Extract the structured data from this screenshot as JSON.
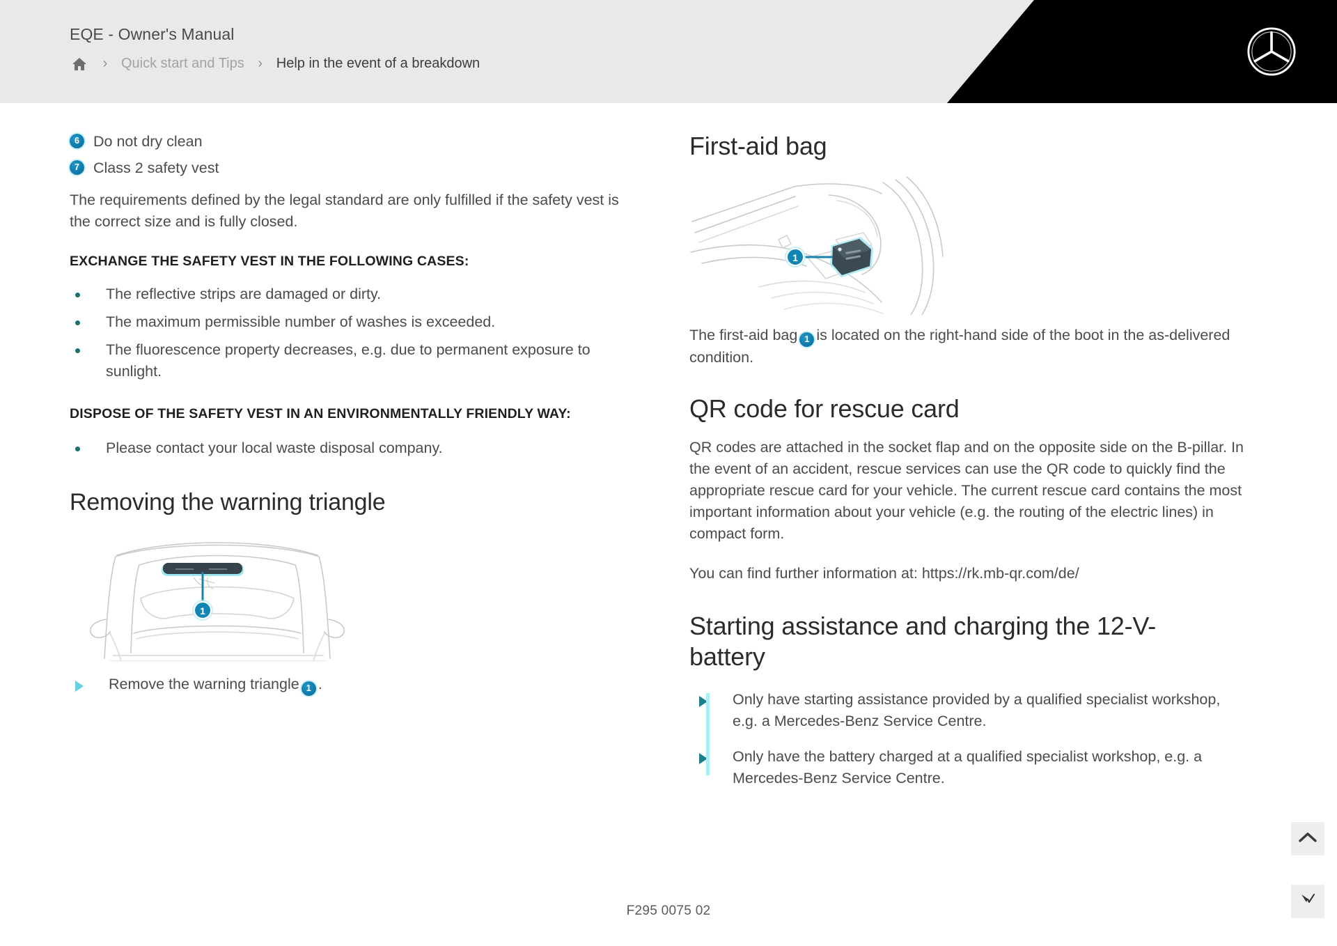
{
  "header": {
    "title": "EQE - Owner's Manual",
    "home_icon": "home-icon",
    "separator": "›",
    "breadcrumb": [
      {
        "label": "Quick start and Tips",
        "current": false
      },
      {
        "label": "Help in the event of a breakdown",
        "current": true
      }
    ],
    "brand_logo": "mercedes-benz-star-logo"
  },
  "left_column": {
    "legend_items": [
      {
        "number": "6",
        "label": "Do not dry clean"
      },
      {
        "number": "7",
        "label": "Class 2 safety vest"
      }
    ],
    "intro_paragraph": "The requirements defined by the legal standard are only fulfilled if the safety vest is the correct size and is fully closed.",
    "exchange_heading": "EXCHANGE THE SAFETY VEST IN THE FOLLOWING CASES:",
    "exchange_bullets": [
      "The reflective strips are damaged or dirty.",
      "The maximum permissible number of washes is exceeded.",
      "The fluorescence property decreases, e.g. due to permanent exposure to sunlight."
    ],
    "dispose_heading": "DISPOSE OF THE SAFETY VEST IN AN ENVIRONMENTALLY FRIENDLY WAY:",
    "dispose_bullets": [
      "Please contact your local waste disposal company."
    ],
    "warning_triangle_heading": "Removing the warning triangle",
    "warning_triangle_figure": {
      "alt": "boot-lid-with-warning-triangle-holder-illustration",
      "callout_number": "1"
    },
    "warning_triangle_step_prefix": "Remove the warning triangle",
    "warning_triangle_step_callout": "1",
    "warning_triangle_step_suffix": "."
  },
  "right_column": {
    "first_aid_heading": "First-aid bag",
    "first_aid_figure": {
      "alt": "boot-compartment-with-first-aid-bag-illustration",
      "callout_number": "1"
    },
    "first_aid_text_before": "The first-aid bag",
    "first_aid_callout": "1",
    "first_aid_text_after": "is located on the right-hand side of the boot in the as-delivered condition.",
    "qr_heading": "QR code for rescue card",
    "qr_paragraph": "QR codes are attached in the socket flap and on the opposite side on the B-pillar. In the event of an accident, rescue services can use the QR code to quickly find the appropriate rescue card for your vehicle. The current rescue card contains the most important information about your vehicle (e.g. the routing of the electric lines) in compact form.",
    "qr_link_paragraph": "You can find further information at: https://rk.mb-qr.com/de/",
    "starting_assistance_heading": "Starting assistance and charging the 12-V-battery",
    "starting_assistance_steps": [
      "Only have starting assistance provided by a qualified specialist workshop, e.g. a Mercedes-Benz Service Centre.",
      "Only have the battery charged at a qualified specialist workshop, e.g. a Mercedes-Benz Service Centre."
    ]
  },
  "footer": {
    "document_code": "F295 0075 02"
  },
  "floating_buttons": {
    "scroll_top": "chevron-up-icon",
    "cursor_tool": "cursor-icon"
  },
  "colors": {
    "header_bg": "#e9e9e9",
    "header_black": "#000000",
    "badge_blue": "#0e7aa9",
    "bullet_teal": "#1f6e6e",
    "rail_cyan": "#a8eef5",
    "arrow_teal": "#1f7d8c",
    "body_text": "#4b4b4b"
  }
}
